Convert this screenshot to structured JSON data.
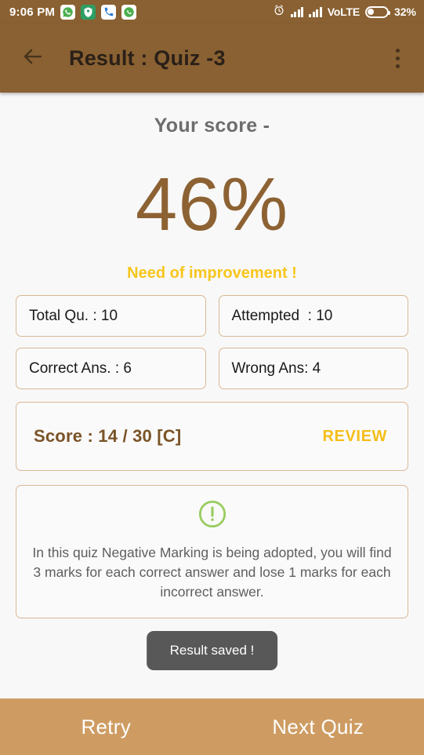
{
  "status_bar": {
    "clock": "9:06 PM",
    "notification_icons": [
      {
        "name": "whatsapp-icon",
        "bg": "#FFFFFF",
        "fg": "#4CAF50"
      },
      {
        "name": "location-shield-icon",
        "bg": "#2E9E63",
        "fg": "#FFFFFF"
      },
      {
        "name": "phone-icon",
        "bg": "#FFFFFF",
        "fg": "#2C7BD6"
      },
      {
        "name": "whatsapp-icon",
        "bg": "#FFFFFF",
        "fg": "#4CAF50"
      }
    ],
    "alarm_icon": "alarm-clock-icon",
    "network_label": "VoLTE",
    "battery_percent_label": "32%",
    "battery_level": 32
  },
  "app_bar": {
    "back_icon": "back-arrow-icon",
    "title": "Result : Quiz -3",
    "overflow_icon": "overflow-menu-icon"
  },
  "result": {
    "score_label": "Your score -",
    "score_percent": "46%",
    "verdict": "Need of improvement !",
    "stats": [
      {
        "name": "total-questions",
        "text": "Total Qu. : 10"
      },
      {
        "name": "attempted",
        "text": "Attempted  : 10"
      },
      {
        "name": "correct-answers",
        "text": "Correct Ans. : 6"
      },
      {
        "name": "wrong-answers",
        "text": "Wrong Ans: 4"
      }
    ],
    "score_detail": "Score : 14 / 30 [C]",
    "review_label": "REVIEW",
    "info_icon": "exclamation-circle-icon",
    "info_text": "In this quiz Negative Marking is being adopted, you will find 3 marks for each correct answer and lose 1 marks for each incorrect answer."
  },
  "toast": {
    "message": "Result saved !"
  },
  "bottom_bar": {
    "retry_label": "Retry",
    "next_label": "Next Quiz"
  },
  "colors": {
    "app_bar": "#8A6132",
    "bottom_bar": "#CE9C62",
    "accent_brown": "#8D6233",
    "accent_yellow": "#F5BE18",
    "card_border": "#D9B894",
    "info_green": "#9ACD62"
  }
}
